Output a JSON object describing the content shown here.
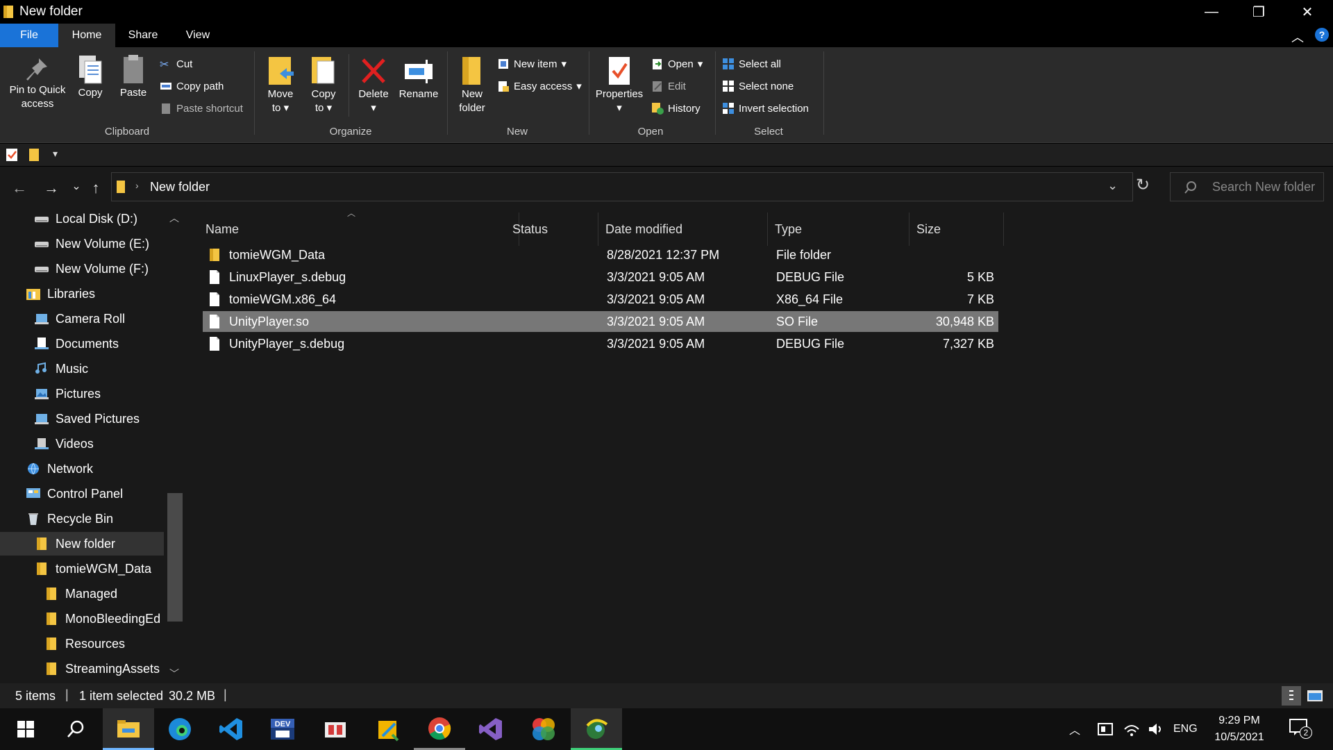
{
  "window": {
    "title": "New folder",
    "controls": {
      "minimize": "—",
      "restore": "❐",
      "close": "✕"
    }
  },
  "tabs": [
    "File",
    "Home",
    "Share",
    "View"
  ],
  "ribbon": {
    "clipboard": {
      "pin": "Pin to Quick access",
      "copy": "Copy",
      "paste": "Paste",
      "cut": "Cut",
      "copy_path": "Copy path",
      "paste_shortcut": "Paste shortcut",
      "label": "Clipboard"
    },
    "organize": {
      "move_to": "Move to",
      "copy_to": "Copy to",
      "delete": "Delete",
      "rename": "Rename",
      "label": "Organize"
    },
    "new": {
      "new_folder": "New folder",
      "new_item": "New item",
      "easy_access": "Easy access",
      "label": "New"
    },
    "open": {
      "properties": "Properties",
      "open": "Open",
      "edit": "Edit",
      "history": "History",
      "label": "Open"
    },
    "select": {
      "select_all": "Select all",
      "select_none": "Select none",
      "invert": "Invert selection",
      "label": "Select"
    }
  },
  "address": {
    "crumb": "New folder",
    "search_placeholder": "Search New folder"
  },
  "sidebar": [
    {
      "label": "Local Disk (D:)",
      "icon": "drive-icon"
    },
    {
      "label": "New Volume (E:)",
      "icon": "drive-icon"
    },
    {
      "label": "New Volume (F:)",
      "icon": "drive-icon"
    },
    {
      "label": "Libraries",
      "icon": "libraries-icon"
    },
    {
      "label": "Camera Roll",
      "icon": "library-icon"
    },
    {
      "label": "Documents",
      "icon": "documents-icon"
    },
    {
      "label": "Music",
      "icon": "music-icon"
    },
    {
      "label": "Pictures",
      "icon": "pictures-icon"
    },
    {
      "label": "Saved Pictures",
      "icon": "library-icon"
    },
    {
      "label": "Videos",
      "icon": "videos-icon"
    },
    {
      "label": "Network",
      "icon": "network-icon"
    },
    {
      "label": "Control Panel",
      "icon": "control-panel-icon"
    },
    {
      "label": "Recycle Bin",
      "icon": "recycle-bin-icon"
    },
    {
      "label": "New folder",
      "icon": "folder-icon"
    },
    {
      "label": "tomieWGM_Data",
      "icon": "folder-icon"
    },
    {
      "label": "Managed",
      "icon": "folder-icon"
    },
    {
      "label": "MonoBleedingEd",
      "icon": "folder-icon"
    },
    {
      "label": "Resources",
      "icon": "folder-icon"
    },
    {
      "label": "StreamingAssets",
      "icon": "folder-icon"
    }
  ],
  "columns": [
    "Name",
    "Status",
    "Date modified",
    "Type",
    "Size"
  ],
  "files": [
    {
      "name": "tomieWGM_Data",
      "date": "8/28/2021 12:37 PM",
      "type": "File folder",
      "size": "",
      "icon": "folder-icon"
    },
    {
      "name": "LinuxPlayer_s.debug",
      "date": "3/3/2021 9:05 AM",
      "type": "DEBUG File",
      "size": "5 KB",
      "icon": "file-icon"
    },
    {
      "name": "tomieWGM.x86_64",
      "date": "3/3/2021 9:05 AM",
      "type": "X86_64 File",
      "size": "7 KB",
      "icon": "file-icon"
    },
    {
      "name": "UnityPlayer.so",
      "date": "3/3/2021 9:05 AM",
      "type": "SO File",
      "size": "30,948 KB",
      "icon": "file-icon",
      "selected": true
    },
    {
      "name": "UnityPlayer_s.debug",
      "date": "3/3/2021 9:05 AM",
      "type": "DEBUG File",
      "size": "7,327 KB",
      "icon": "file-icon"
    }
  ],
  "status": {
    "items": "5 items",
    "selected": "1 item selected",
    "size": "30.2 MB"
  },
  "taskbar": {
    "language": "ENG",
    "time": "9:29 PM",
    "date": "10/5/2021",
    "notifications": "2"
  },
  "colors": {
    "file_tab": "#1a73d8",
    "ribbon": "#2b2b2b",
    "selection": "#777777",
    "folder": "#f4c542"
  }
}
